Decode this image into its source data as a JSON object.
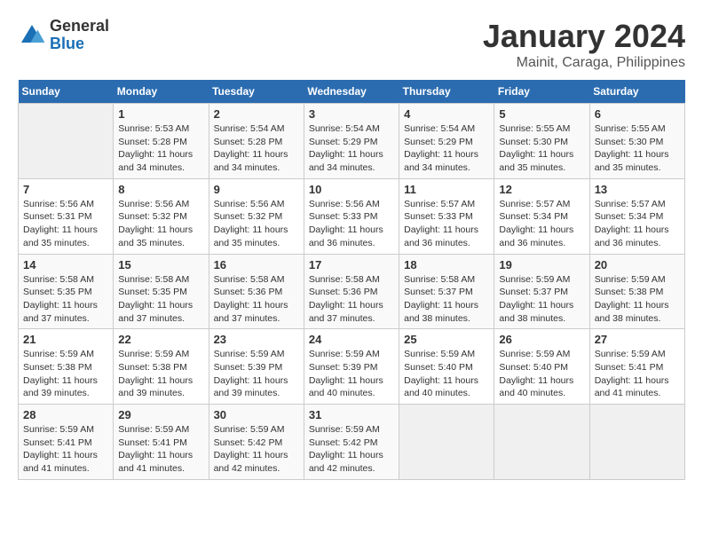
{
  "header": {
    "logo": {
      "general": "General",
      "blue": "Blue"
    },
    "title": "January 2024",
    "location": "Mainit, Caraga, Philippines"
  },
  "weekdays": [
    "Sunday",
    "Monday",
    "Tuesday",
    "Wednesday",
    "Thursday",
    "Friday",
    "Saturday"
  ],
  "weeks": [
    [
      {
        "day": "",
        "sunrise": "",
        "sunset": "",
        "daylight": ""
      },
      {
        "day": "1",
        "sunrise": "Sunrise: 5:53 AM",
        "sunset": "Sunset: 5:28 PM",
        "daylight": "Daylight: 11 hours and 34 minutes."
      },
      {
        "day": "2",
        "sunrise": "Sunrise: 5:54 AM",
        "sunset": "Sunset: 5:28 PM",
        "daylight": "Daylight: 11 hours and 34 minutes."
      },
      {
        "day": "3",
        "sunrise": "Sunrise: 5:54 AM",
        "sunset": "Sunset: 5:29 PM",
        "daylight": "Daylight: 11 hours and 34 minutes."
      },
      {
        "day": "4",
        "sunrise": "Sunrise: 5:54 AM",
        "sunset": "Sunset: 5:29 PM",
        "daylight": "Daylight: 11 hours and 34 minutes."
      },
      {
        "day": "5",
        "sunrise": "Sunrise: 5:55 AM",
        "sunset": "Sunset: 5:30 PM",
        "daylight": "Daylight: 11 hours and 35 minutes."
      },
      {
        "day": "6",
        "sunrise": "Sunrise: 5:55 AM",
        "sunset": "Sunset: 5:30 PM",
        "daylight": "Daylight: 11 hours and 35 minutes."
      }
    ],
    [
      {
        "day": "7",
        "sunrise": "Sunrise: 5:56 AM",
        "sunset": "Sunset: 5:31 PM",
        "daylight": "Daylight: 11 hours and 35 minutes."
      },
      {
        "day": "8",
        "sunrise": "Sunrise: 5:56 AM",
        "sunset": "Sunset: 5:32 PM",
        "daylight": "Daylight: 11 hours and 35 minutes."
      },
      {
        "day": "9",
        "sunrise": "Sunrise: 5:56 AM",
        "sunset": "Sunset: 5:32 PM",
        "daylight": "Daylight: 11 hours and 35 minutes."
      },
      {
        "day": "10",
        "sunrise": "Sunrise: 5:56 AM",
        "sunset": "Sunset: 5:33 PM",
        "daylight": "Daylight: 11 hours and 36 minutes."
      },
      {
        "day": "11",
        "sunrise": "Sunrise: 5:57 AM",
        "sunset": "Sunset: 5:33 PM",
        "daylight": "Daylight: 11 hours and 36 minutes."
      },
      {
        "day": "12",
        "sunrise": "Sunrise: 5:57 AM",
        "sunset": "Sunset: 5:34 PM",
        "daylight": "Daylight: 11 hours and 36 minutes."
      },
      {
        "day": "13",
        "sunrise": "Sunrise: 5:57 AM",
        "sunset": "Sunset: 5:34 PM",
        "daylight": "Daylight: 11 hours and 36 minutes."
      }
    ],
    [
      {
        "day": "14",
        "sunrise": "Sunrise: 5:58 AM",
        "sunset": "Sunset: 5:35 PM",
        "daylight": "Daylight: 11 hours and 37 minutes."
      },
      {
        "day": "15",
        "sunrise": "Sunrise: 5:58 AM",
        "sunset": "Sunset: 5:35 PM",
        "daylight": "Daylight: 11 hours and 37 minutes."
      },
      {
        "day": "16",
        "sunrise": "Sunrise: 5:58 AM",
        "sunset": "Sunset: 5:36 PM",
        "daylight": "Daylight: 11 hours and 37 minutes."
      },
      {
        "day": "17",
        "sunrise": "Sunrise: 5:58 AM",
        "sunset": "Sunset: 5:36 PM",
        "daylight": "Daylight: 11 hours and 37 minutes."
      },
      {
        "day": "18",
        "sunrise": "Sunrise: 5:58 AM",
        "sunset": "Sunset: 5:37 PM",
        "daylight": "Daylight: 11 hours and 38 minutes."
      },
      {
        "day": "19",
        "sunrise": "Sunrise: 5:59 AM",
        "sunset": "Sunset: 5:37 PM",
        "daylight": "Daylight: 11 hours and 38 minutes."
      },
      {
        "day": "20",
        "sunrise": "Sunrise: 5:59 AM",
        "sunset": "Sunset: 5:38 PM",
        "daylight": "Daylight: 11 hours and 38 minutes."
      }
    ],
    [
      {
        "day": "21",
        "sunrise": "Sunrise: 5:59 AM",
        "sunset": "Sunset: 5:38 PM",
        "daylight": "Daylight: 11 hours and 39 minutes."
      },
      {
        "day": "22",
        "sunrise": "Sunrise: 5:59 AM",
        "sunset": "Sunset: 5:38 PM",
        "daylight": "Daylight: 11 hours and 39 minutes."
      },
      {
        "day": "23",
        "sunrise": "Sunrise: 5:59 AM",
        "sunset": "Sunset: 5:39 PM",
        "daylight": "Daylight: 11 hours and 39 minutes."
      },
      {
        "day": "24",
        "sunrise": "Sunrise: 5:59 AM",
        "sunset": "Sunset: 5:39 PM",
        "daylight": "Daylight: 11 hours and 40 minutes."
      },
      {
        "day": "25",
        "sunrise": "Sunrise: 5:59 AM",
        "sunset": "Sunset: 5:40 PM",
        "daylight": "Daylight: 11 hours and 40 minutes."
      },
      {
        "day": "26",
        "sunrise": "Sunrise: 5:59 AM",
        "sunset": "Sunset: 5:40 PM",
        "daylight": "Daylight: 11 hours and 40 minutes."
      },
      {
        "day": "27",
        "sunrise": "Sunrise: 5:59 AM",
        "sunset": "Sunset: 5:41 PM",
        "daylight": "Daylight: 11 hours and 41 minutes."
      }
    ],
    [
      {
        "day": "28",
        "sunrise": "Sunrise: 5:59 AM",
        "sunset": "Sunset: 5:41 PM",
        "daylight": "Daylight: 11 hours and 41 minutes."
      },
      {
        "day": "29",
        "sunrise": "Sunrise: 5:59 AM",
        "sunset": "Sunset: 5:41 PM",
        "daylight": "Daylight: 11 hours and 41 minutes."
      },
      {
        "day": "30",
        "sunrise": "Sunrise: 5:59 AM",
        "sunset": "Sunset: 5:42 PM",
        "daylight": "Daylight: 11 hours and 42 minutes."
      },
      {
        "day": "31",
        "sunrise": "Sunrise: 5:59 AM",
        "sunset": "Sunset: 5:42 PM",
        "daylight": "Daylight: 11 hours and 42 minutes."
      },
      {
        "day": "",
        "sunrise": "",
        "sunset": "",
        "daylight": ""
      },
      {
        "day": "",
        "sunrise": "",
        "sunset": "",
        "daylight": ""
      },
      {
        "day": "",
        "sunrise": "",
        "sunset": "",
        "daylight": ""
      }
    ]
  ]
}
